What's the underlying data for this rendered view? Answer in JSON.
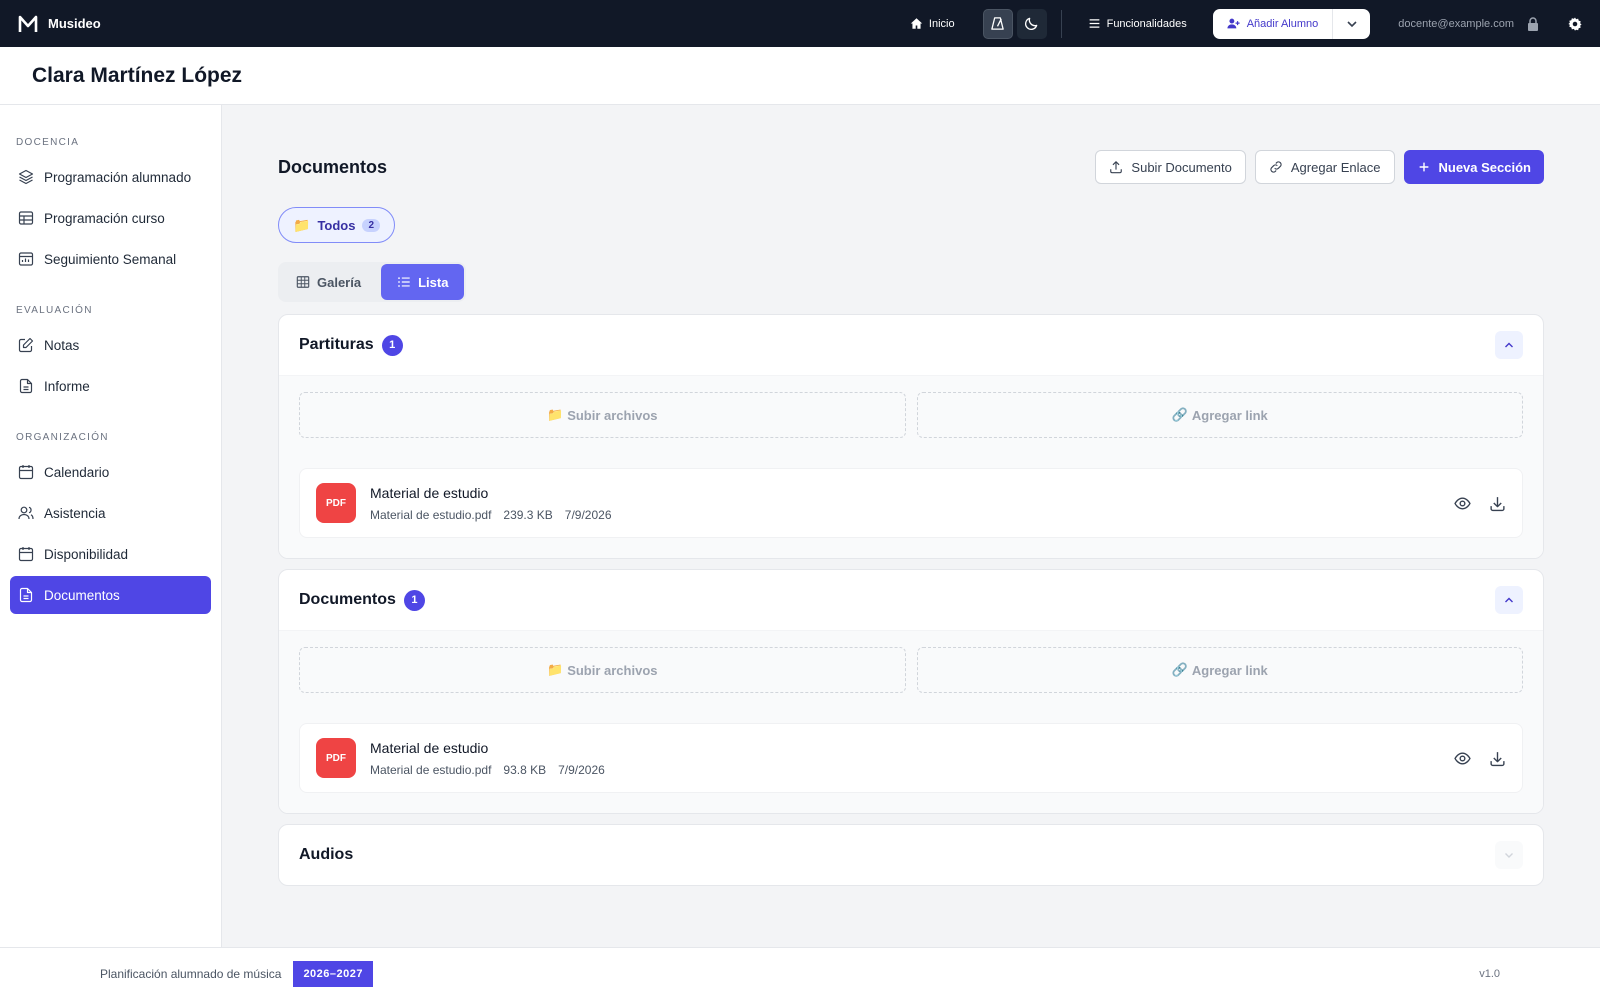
{
  "topbar": {
    "brand": "Musideo",
    "home_label": "Inicio",
    "features_label": "Funcionalidades",
    "add_student_label": "Añadir Alumno",
    "user_email": "docente@example.com"
  },
  "page": {
    "student_name": "Clara Martínez López"
  },
  "sidebar": {
    "sections": [
      {
        "title": "DOCENCIA",
        "items": [
          {
            "label": "Programación alumnado",
            "icon": "layers-icon"
          },
          {
            "label": "Programación curso",
            "icon": "table-icon"
          },
          {
            "label": "Seguimiento Semanal",
            "icon": "calendar-chart-icon"
          }
        ]
      },
      {
        "title": "EVALUACIÓN",
        "items": [
          {
            "label": "Notas",
            "icon": "edit-icon"
          },
          {
            "label": "Informe",
            "icon": "file-icon"
          }
        ]
      },
      {
        "title": "ORGANIZACIÓN",
        "items": [
          {
            "label": "Calendario",
            "icon": "calendar-icon"
          },
          {
            "label": "Asistencia",
            "icon": "users-icon"
          },
          {
            "label": "Disponibilidad",
            "icon": "calendar-icon"
          },
          {
            "label": "Documentos",
            "icon": "file-text-icon",
            "active": true
          }
        ]
      }
    ]
  },
  "main": {
    "title": "Documentos",
    "actions": {
      "upload": "Subir Documento",
      "add_link": "Agregar Enlace",
      "new_section": "Nueva Sección"
    },
    "filter": {
      "emoji": "📁",
      "label": "Todos",
      "count": "2"
    },
    "view_tabs": {
      "gallery": "Galería",
      "list": "Lista",
      "active": "list"
    },
    "sections": [
      {
        "title": "Partituras",
        "count": "1",
        "expanded": true,
        "upload_label": "Subir archivos",
        "upload_emoji": "📁",
        "link_label": "Agregar link",
        "link_emoji": "🔗",
        "files": [
          {
            "type": "PDF",
            "name": "Material de estudio",
            "filename": "Material de estudio.pdf",
            "size": "239.3 KB",
            "date": "7/9/2026"
          }
        ]
      },
      {
        "title": "Documentos",
        "count": "1",
        "expanded": true,
        "upload_label": "Subir archivos",
        "upload_emoji": "📁",
        "link_label": "Agregar link",
        "link_emoji": "🔗",
        "files": [
          {
            "type": "PDF",
            "name": "Material de estudio",
            "filename": "Material de estudio.pdf",
            "size": "93.8 KB",
            "date": "7/9/2026"
          }
        ]
      },
      {
        "title": "Audios",
        "expanded": false
      }
    ]
  },
  "footer": {
    "text": "Planificación alumnado de música",
    "year": "2026–2027",
    "version": "v1.0"
  },
  "colors": {
    "accent": "#4f46e5",
    "topbar": "#111827",
    "pdf": "#ef4444"
  }
}
